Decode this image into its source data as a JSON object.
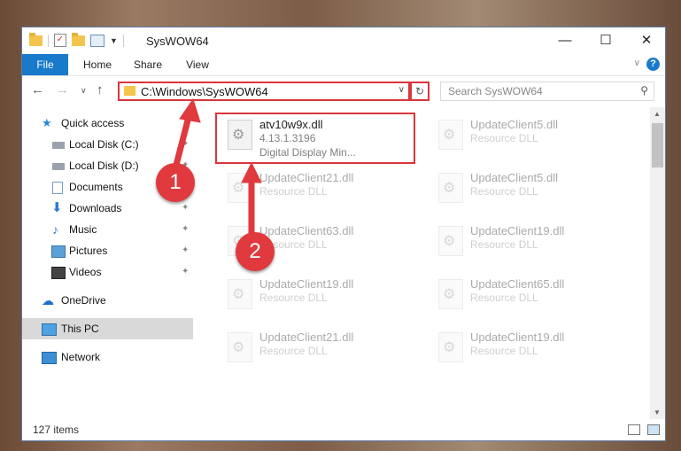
{
  "window": {
    "title": "SysWOW64"
  },
  "ribbon": {
    "tabs": [
      "File",
      "Home",
      "Share",
      "View"
    ]
  },
  "nav": {
    "address": "C:\\Windows\\SysWOW64",
    "search_placeholder": "Search SysWOW64"
  },
  "sidebar": {
    "items": [
      {
        "label": "Quick access",
        "icon": "star-icon"
      },
      {
        "label": "Local Disk (C:)",
        "icon": "drive-icon"
      },
      {
        "label": "Local Disk (D:)",
        "icon": "drive-icon"
      },
      {
        "label": "Documents",
        "icon": "documents-icon"
      },
      {
        "label": "Downloads",
        "icon": "download-icon"
      },
      {
        "label": "Music",
        "icon": "music-icon"
      },
      {
        "label": "Pictures",
        "icon": "pictures-icon"
      },
      {
        "label": "Videos",
        "icon": "videos-icon"
      },
      {
        "label": "OneDrive",
        "icon": "cloud-icon"
      },
      {
        "label": "This PC",
        "icon": "computer-icon"
      },
      {
        "label": "Network",
        "icon": "network-icon"
      }
    ]
  },
  "files": [
    {
      "name": "atv10w9x.dll",
      "version": "4.13.1.3196",
      "desc": "Digital Display Min..."
    },
    {
      "name": "UpdateClient5.dll",
      "type": "Resource DLL"
    },
    {
      "name": "UpdateClient21.dll",
      "type": "Resource DLL"
    },
    {
      "name": "UpdateClient5.dll",
      "type": "Resource DLL"
    },
    {
      "name": "UpdateClient63.dll",
      "type": "Resource DLL"
    },
    {
      "name": "UpdateClient19.dll",
      "type": "Resource DLL"
    },
    {
      "name": "UpdateClient19.dll",
      "type": "Resource DLL"
    },
    {
      "name": "UpdateClient65.dll",
      "type": "Resource DLL"
    },
    {
      "name": "UpdateClient21.dll",
      "type": "Resource DLL"
    },
    {
      "name": "UpdateClient19.dll",
      "type": "Resource DLL"
    }
  ],
  "status": {
    "count": "127 items"
  },
  "annotations": {
    "step1": "1",
    "step2": "2",
    "color": "#e0393e"
  }
}
